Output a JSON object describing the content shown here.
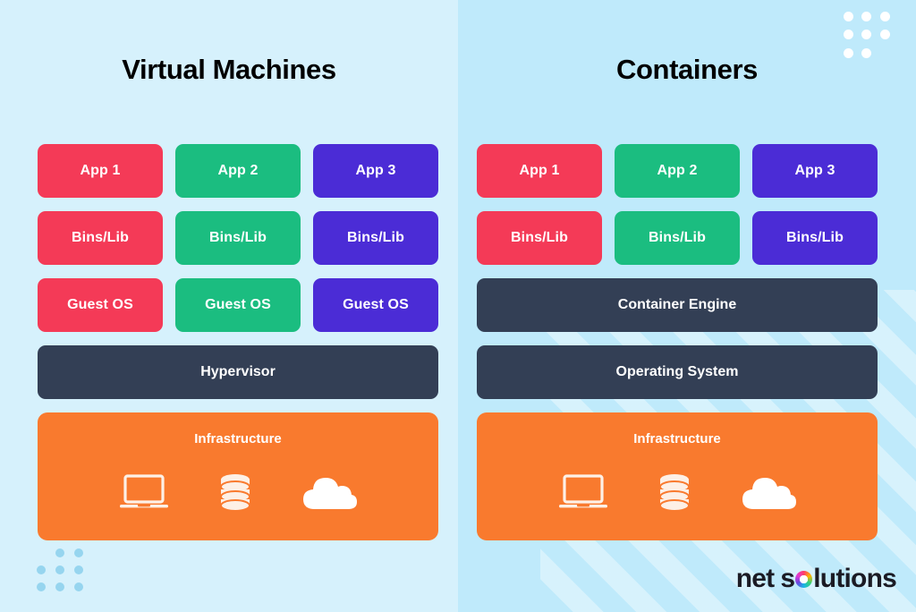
{
  "panels": [
    {
      "id": "virtual-machines",
      "title": "Virtual Machines",
      "rows": [
        {
          "type": "triple",
          "cells": [
            {
              "label": "App 1",
              "color": "red"
            },
            {
              "label": "App 2",
              "color": "green"
            },
            {
              "label": "App 3",
              "color": "purple"
            }
          ]
        },
        {
          "type": "triple",
          "cells": [
            {
              "label": "Bins/Lib",
              "color": "red"
            },
            {
              "label": "Bins/Lib",
              "color": "green"
            },
            {
              "label": "Bins/Lib",
              "color": "purple"
            }
          ]
        },
        {
          "type": "triple",
          "cells": [
            {
              "label": "Guest OS",
              "color": "red"
            },
            {
              "label": "Guest OS",
              "color": "green"
            },
            {
              "label": "Guest OS",
              "color": "purple"
            }
          ]
        },
        {
          "type": "bar",
          "label": "Hypervisor",
          "color": "dark"
        }
      ],
      "infrastructure": {
        "label": "Infrastructure",
        "color": "#f97a2e",
        "icons": [
          "laptop-icon",
          "database-icon",
          "cloud-icon"
        ]
      }
    },
    {
      "id": "containers",
      "title": "Containers",
      "rows": [
        {
          "type": "triple",
          "cells": [
            {
              "label": "App 1",
              "color": "red"
            },
            {
              "label": "App 2",
              "color": "green"
            },
            {
              "label": "App 3",
              "color": "purple"
            }
          ]
        },
        {
          "type": "triple",
          "cells": [
            {
              "label": "Bins/Lib",
              "color": "red"
            },
            {
              "label": "Bins/Lib",
              "color": "green"
            },
            {
              "label": "Bins/Lib",
              "color": "purple"
            }
          ]
        },
        {
          "type": "bar",
          "label": "Container Engine",
          "color": "dark"
        },
        {
          "type": "bar",
          "label": "Operating System",
          "color": "dark"
        }
      ],
      "infrastructure": {
        "label": "Infrastructure",
        "color": "#f97a2e",
        "icons": [
          "laptop-icon",
          "database-icon",
          "cloud-icon"
        ]
      }
    }
  ],
  "brand": {
    "word_one": "net",
    "word_two_prefix": "s",
    "word_two_suffix": "lutions",
    "ring_icon": "multicolor-ring-icon"
  },
  "colors": {
    "background_left": "#d6f1fc",
    "background_right": "#bfeafb",
    "red": "#f43a57",
    "green": "#1bbd80",
    "purple": "#4b2cd6",
    "dark": "#333f55",
    "orange": "#f97a2e",
    "title_text": "#000000",
    "cell_text": "#ffffff",
    "dots_light": "#ffffff",
    "dots_blue": "#96d5ef"
  },
  "decorations": {
    "dots_top_right": "dot-grid-8-white",
    "dots_bottom_left": "dot-grid-8-blue",
    "diagonal_stripes": "diagonal-stripes-bottom-right"
  }
}
